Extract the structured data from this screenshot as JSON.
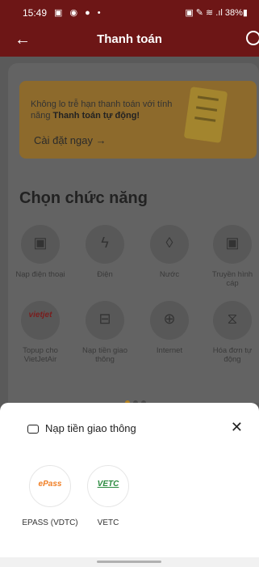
{
  "status": {
    "time": "15:49",
    "icons": "▣ ◉ ● •",
    "right": "▣ ✎ ≋ .ıl 38%▮"
  },
  "header": {
    "title": "Thanh toán"
  },
  "banner": {
    "line1": "Không lo trễ hạn thanh toán với tính năng ",
    "line1_bold": "Thanh toán tự động!",
    "cta": "Cài đặt ngay →"
  },
  "section_title": "Chọn chức năng",
  "grid": [
    {
      "icon": "phone-top-up-icon",
      "glyph": "▣",
      "label": "Nạp điện thoại"
    },
    {
      "icon": "lightning-icon",
      "glyph": "ϟ",
      "label": "Điện"
    },
    {
      "icon": "water-drop-icon",
      "glyph": "◊",
      "label": "Nước"
    },
    {
      "icon": "tv-icon",
      "glyph": "▣",
      "label": "Truyền hình cáp"
    },
    {
      "icon": "vietjet-logo",
      "glyph": "vietjet",
      "label": "Topup cho VietJetAir"
    },
    {
      "icon": "car-icon",
      "glyph": "⊟",
      "label": "Nạp tiền giao thông"
    },
    {
      "icon": "globe-icon",
      "glyph": "⊕",
      "label": "Internet"
    },
    {
      "icon": "bill-clock-icon",
      "glyph": "⧖",
      "label": "Hóa đơn tự động"
    }
  ],
  "sheet": {
    "title": "Nạp tiền giao thông",
    "close": "✕",
    "providers": [
      {
        "logo": "ePass",
        "name": "EPASS (VDTC)",
        "color": "#f07d22"
      },
      {
        "logo": "VETC",
        "name": "VETC",
        "color": "#2a8a3e"
      }
    ]
  }
}
